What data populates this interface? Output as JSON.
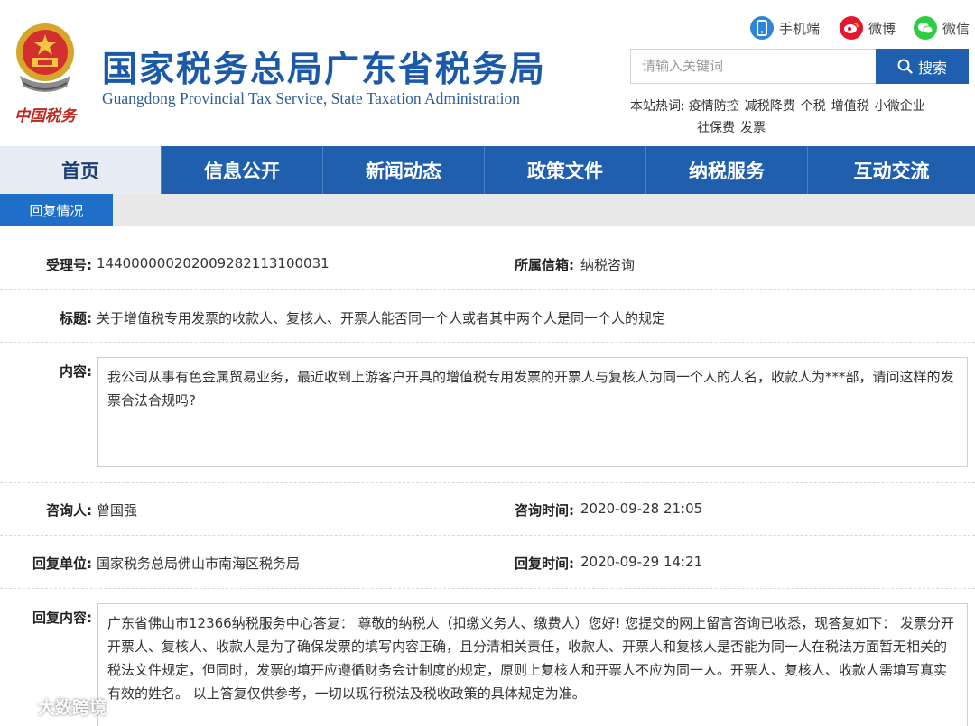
{
  "header": {
    "title_cn": "国家税务总局广东省税务局",
    "title_en": "Guangdong Provincial Tax Service, State Taxation Administration",
    "emblem_caption": "中国税务",
    "social": {
      "mobile": "手机端",
      "weibo": "微博",
      "wechat": "微信"
    },
    "search": {
      "placeholder": "请输入关键词",
      "button_label": "搜索"
    },
    "hot": {
      "label": "本站热词:",
      "keywords": [
        "疫情防控",
        "减税降费",
        "个税",
        "增值税",
        "小微企业",
        "社保费",
        "发票"
      ]
    }
  },
  "nav": {
    "items": [
      "首页",
      "信息公开",
      "新闻动态",
      "政策文件",
      "纳税服务",
      "互动交流"
    ],
    "active_index": 0
  },
  "subtab": "回复情况",
  "detail": {
    "id_label": "受理号:",
    "id_value": "144000000202009282113100031",
    "mailbox_label": "所属信箱:",
    "mailbox_value": "纳税咨询",
    "title_label": "标题:",
    "title_value": "关于增值税专用发票的收款人、复核人、开票人能否同一个人或者其中两个人是同一个人的规定",
    "content_label": "内容:",
    "content_value": "我公司从事有色金属贸易业务，最近收到上游客户开具的增值税专用发票的开票人与复核人为同一个人的人名，收款人为***部，请问这样的发票合法合规吗?",
    "asker_label": "咨询人:",
    "asker_value": "曾国强",
    "ask_time_label": "咨询时间:",
    "ask_time_value": "2020-09-28 21:05",
    "reply_unit_label": "回复单位:",
    "reply_unit_value": "国家税务总局佛山市南海区税务局",
    "reply_time_label": "回复时间:",
    "reply_time_value": "2020-09-29 14:21",
    "reply_content_label": "回复内容:",
    "reply_content_value": "广东省佛山市12366纳税服务中心答复： 尊敬的纳税人（扣缴义务人、缴费人）您好! 您提交的网上留言咨询已收悉，现答复如下： 发票分开开票人、复核人、收款人是为了确保发票的填写内容正确，且分清相关责任，收款人、开票人和复核人是否能为同一人在税法方面暂无相关的税法文件规定，但同时，发票的填开应遵循财务会计制度的规定，原则上复核人和开票人不应为同一人。开票人、复核人、收款人需填写真实有效的姓名。 以上答复仅供参考，一切以现行税法及税收政策的具体规定为准。"
  },
  "watermark": "大数跨境",
  "colors": {
    "brand_blue": "#1f5fae",
    "title_blue": "#1a5aa8",
    "subtab_blue": "#1f6fc9",
    "active_nav_bg": "#e8edf5"
  }
}
